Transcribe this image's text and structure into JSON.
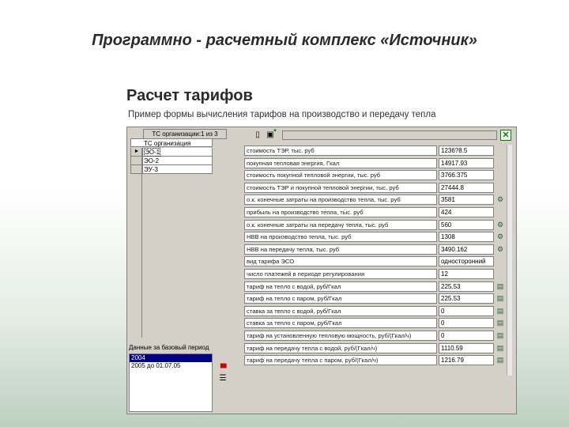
{
  "slide": {
    "title": "Программно - расчетный комплекс «Источник»",
    "section": "Расчет тарифов",
    "caption": "Пример формы вычисления тарифов на производство и передачу тепла"
  },
  "organizations": {
    "count_label": "ТС организации:1 из 3",
    "header": "ТС организация",
    "items": [
      "ЭО-1",
      "ЭО-2",
      "ЭУ-3"
    ]
  },
  "base_period": {
    "label": "Данные за базовый период",
    "items": [
      "2004",
      "2005 до 01.07.05"
    ]
  },
  "parameters": [
    {
      "name": "стоимость ТЭР, тыс. руб",
      "value": "1236?8.5",
      "icon": "none"
    },
    {
      "name": "покупная тепловая энергия, Гкал",
      "value": "14917.93",
      "icon": "none"
    },
    {
      "name": "стоимость покупной тепловой энергии, тыс. руб",
      "value": "3766.375",
      "icon": "none"
    },
    {
      "name": "стоимость ТЭР и покупной тепловой энергии, тыс. руб",
      "value": "27444.8",
      "icon": "none"
    },
    {
      "name": "о.к. конечные затраты на производство тепла, тыс. руб",
      "value": "3581",
      "icon": "settings"
    },
    {
      "name": "прибыль на производство тепла, тыс. руб",
      "value": "424",
      "icon": "none"
    },
    {
      "name": "о.к. конечные затраты на передачу тепла, тыс. руб",
      "value": "560",
      "icon": "settings"
    },
    {
      "name": "НВВ на производство тепла, тыс. руб",
      "value": "1308",
      "icon": "settings"
    },
    {
      "name": "НВВ на передачу тепла, тыс. руб",
      "value": "3490.162",
      "icon": "settings"
    },
    {
      "name": "вид тарифа ЭСО",
      "value": "односторонний",
      "icon": "none"
    },
    {
      "name": "число платежей в периоде регулирования",
      "value": "12",
      "icon": "none"
    },
    {
      "name": "тариф на тепло с водой, руб/Гкал",
      "value": "225.53",
      "icon": "calc"
    },
    {
      "name": "тариф на тепло с паром, руб/Гкал",
      "value": "225.53",
      "icon": "calc"
    },
    {
      "name": "ставка за тепло с водой, руб/Гкал",
      "value": "0",
      "icon": "calc"
    },
    {
      "name": "ставка за тепло с паром, руб/Гкал",
      "value": "0",
      "icon": "calc"
    },
    {
      "name": "тариф на установленную тепловую мощность, руб/(Гкал/ч)",
      "value": "0",
      "icon": "calc"
    },
    {
      "name": "тариф на передачу тепла с водой, руб/(Гкал/ч)",
      "value": "1110.59",
      "icon": "calc"
    },
    {
      "name": "тариф на передачу тепла с паром, руб/(Гкал/ч)",
      "value": "1216.79",
      "icon": "calc"
    }
  ],
  "colors": {
    "window_bg": "#d4d0c8",
    "selection": "#000080",
    "close_icon": "#008000"
  }
}
